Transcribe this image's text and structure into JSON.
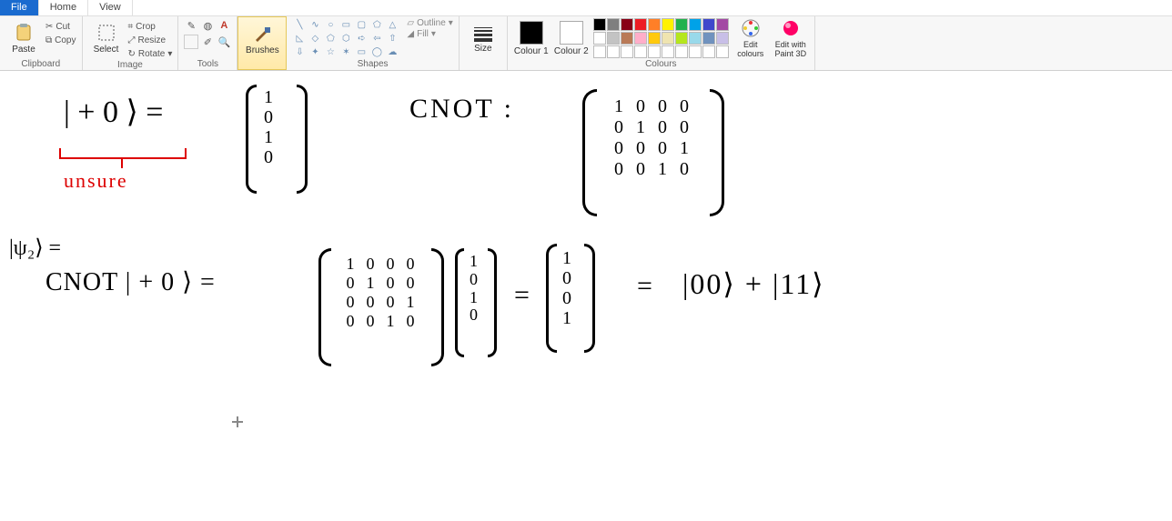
{
  "tabs": {
    "file": "File",
    "home": "Home",
    "view": "View"
  },
  "clipboard": {
    "paste": "Paste",
    "cut": "Cut",
    "copy": "Copy",
    "label": "Clipboard"
  },
  "image": {
    "select": "Select",
    "crop": "Crop",
    "resize": "Resize",
    "rotate": "Rotate",
    "label": "Image"
  },
  "tools": {
    "label": "Tools"
  },
  "brushes": {
    "label": "Brushes"
  },
  "shapes": {
    "outline": "Outline",
    "fill": "Fill",
    "label": "Shapes"
  },
  "size": {
    "label": "Size"
  },
  "colours": {
    "c1": "Colour 1",
    "c2": "Colour 2",
    "edit": "Edit colours",
    "edit3d": "Edit with Paint 3D",
    "label": "Colours",
    "colour1_hex": "#000000",
    "colour2_hex": "#ffffff",
    "palette_row1": [
      "#000000",
      "#7f7f7f",
      "#880015",
      "#ed1c24",
      "#ff7f27",
      "#fff200",
      "#22b14c",
      "#00a2e8",
      "#3f48cc",
      "#a349a4"
    ],
    "palette_row2": [
      "#ffffff",
      "#c3c3c3",
      "#b97a57",
      "#ffaec9",
      "#ffc90e",
      "#efe4b0",
      "#b5e61d",
      "#99d9ea",
      "#7092be",
      "#c8bfe7"
    ],
    "palette_row3": [
      "#ffffff",
      "#ffffff",
      "#ffffff",
      "#ffffff",
      "#ffffff",
      "#ffffff",
      "#ffffff",
      "#ffffff",
      "#ffffff",
      "#ffffff"
    ]
  },
  "canvas": {
    "expr1": "| + 0 ⟩  =",
    "vec1": [
      "1",
      "0",
      "1",
      "0"
    ],
    "bracket_label": "unsure",
    "cnot_label": "CNOT :",
    "cnot_matrix": [
      "1",
      "0",
      "0",
      "0",
      "0",
      "1",
      "0",
      "0",
      "0",
      "0",
      "0",
      "1",
      "0",
      "0",
      "1",
      "0"
    ],
    "psi2": "|ψ₂⟩ =",
    "expr2": "CNOT  | + 0 ⟩   =",
    "mat2": [
      "1",
      "0",
      "0",
      "0",
      "0",
      "1",
      "0",
      "0",
      "0",
      "0",
      "0",
      "1",
      "0",
      "0",
      "1",
      "0"
    ],
    "vec2": [
      "1",
      "0",
      "1",
      "0"
    ],
    "eq1": "=",
    "vec3": [
      "1",
      "0",
      "0",
      "1"
    ],
    "eq2": "=",
    "result": "|00⟩  + |11⟩"
  }
}
